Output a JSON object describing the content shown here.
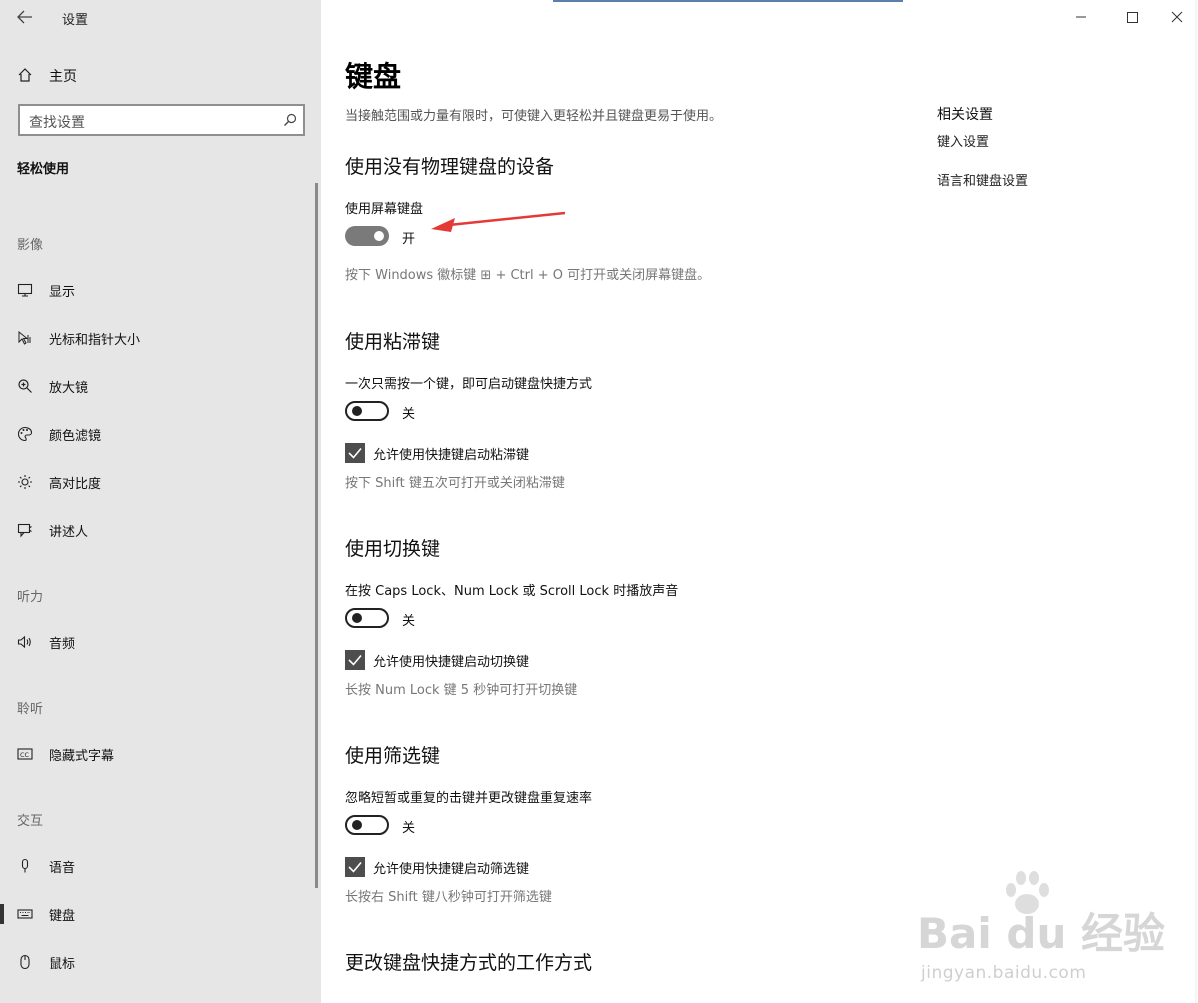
{
  "window": {
    "title": "设置",
    "controls": [
      "minimize-icon",
      "maximize-icon",
      "close-icon"
    ]
  },
  "sidebar": {
    "home_label": "主页",
    "search_placeholder": "查找设置",
    "category": "轻松使用",
    "groups": [
      {
        "label": "影像"
      },
      {
        "label": "听力"
      },
      {
        "label": "聆听"
      },
      {
        "label": "交互"
      }
    ],
    "items": [
      {
        "label": "显示",
        "icon": "monitor-icon"
      },
      {
        "label": "光标和指针大小",
        "icon": "cursor-icon"
      },
      {
        "label": "放大镜",
        "icon": "magnifier-icon"
      },
      {
        "label": "颜色滤镜",
        "icon": "palette-icon"
      },
      {
        "label": "高对比度",
        "icon": "brightness-icon"
      },
      {
        "label": "讲述人",
        "icon": "narrator-icon"
      },
      {
        "label": "音频",
        "icon": "speaker-icon"
      },
      {
        "label": "隐藏式字幕",
        "icon": "cc-icon"
      },
      {
        "label": "语音",
        "icon": "microphone-icon"
      },
      {
        "label": "键盘",
        "icon": "keyboard-icon",
        "active": true
      },
      {
        "label": "鼠标",
        "icon": "mouse-icon"
      }
    ]
  },
  "main": {
    "title": "键盘",
    "description": "当接触范围或力量有限时，可使键入更轻松并且键盘更易于使用。",
    "sections": [
      {
        "title": "使用没有物理键盘的设备",
        "setting_label": "使用屏幕键盘",
        "toggle_state": "开",
        "toggle_on": true,
        "hint": "按下 Windows 徽标键 ⊞ + Ctrl + O 可打开或关闭屏幕键盘。"
      },
      {
        "title": "使用粘滞键",
        "setting_label": "一次只需按一个键，即可启动键盘快捷方式",
        "toggle_state": "关",
        "toggle_on": false,
        "checkbox_label": "允许使用快捷键启动粘滞键",
        "checkbox_checked": true,
        "hint": "按下 Shift 键五次可打开或关闭粘滞键"
      },
      {
        "title": "使用切换键",
        "setting_label": "在按 Caps Lock、Num Lock 或 Scroll Lock 时播放声音",
        "toggle_state": "关",
        "toggle_on": false,
        "checkbox_label": "允许使用快捷键启动切换键",
        "checkbox_checked": true,
        "hint": "长按 Num Lock 键 5 秒钟可打开切换键"
      },
      {
        "title": "使用筛选键",
        "setting_label": "忽略短暂或重复的击键并更改键盘重复速率",
        "toggle_state": "关",
        "toggle_on": false,
        "checkbox_label": "允许使用快捷键启动筛选键",
        "checkbox_checked": true,
        "hint": "长按右 Shift 键八秒钟可打开筛选键"
      },
      {
        "title": "更改键盘快捷方式的工作方式"
      }
    ]
  },
  "related": {
    "title": "相关设置",
    "links": [
      "键入设置",
      "语言和键盘设置"
    ]
  },
  "watermark": {
    "brand": "Bai du 经验",
    "url": "jingyan.baidu.com"
  },
  "colors": {
    "sidebar_bg": "#e6e6e6",
    "annotation_arrow": "#e53935",
    "toggle_on": "#7a7a7a",
    "checkbox": "#4d4d4d"
  }
}
